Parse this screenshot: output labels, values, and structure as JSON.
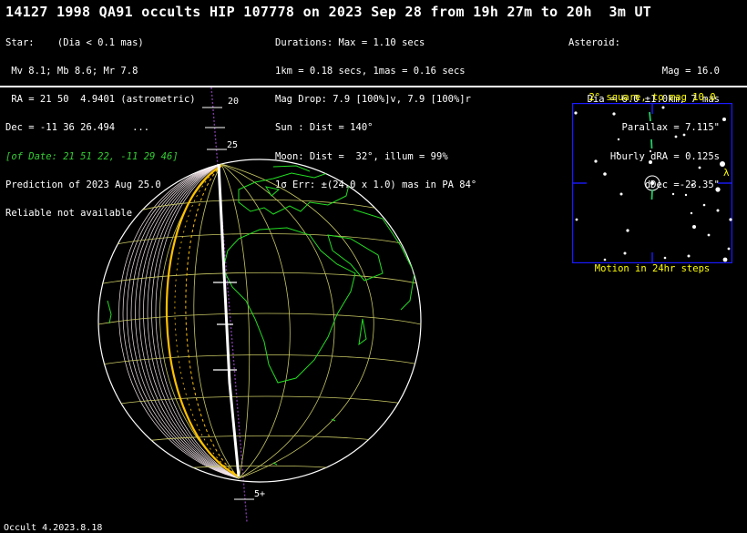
{
  "header": {
    "title": "14127 1998 QA91 occults HIP 107778 on 2023 Sep 28 from 19h 27m to 20h  3m UT"
  },
  "star": {
    "lines": [
      "Star:    (Dia < 0.1 mas)",
      " Mv 8.1; Mb 8.6; Mr 7.8",
      " RA = 21 50  4.9401 (astrometric)",
      "Dec = -11 36 26.494   ...",
      "[of Date: 21 51 22, -11 29 46]",
      "Prediction of 2023 Aug 25.0",
      "Reliable not available"
    ]
  },
  "event": {
    "lines": [
      "Durations: Max = 1.10 secs",
      "1km = 0.18 secs, 1mas = 0.16 secs",
      "Mag Drop: 7.9 [100%]v, 7.9 [100%]r",
      "Sun : Dist = 140°",
      "Moon: Dist =  32°, illum = 99%",
      "1σ Err: ±(24.0 x 1.0) mas in PA 84°"
    ]
  },
  "asteroid": {
    "heading": "Asteroid:",
    "lines": [
      "Mag = 16.0",
      "Dia = 6.0 ±1.0km, 7 mas",
      "Parallax = 7.115\"",
      "Hourly dRA = 0.125s",
      "dDec =-23.35\""
    ]
  },
  "track_labels": [
    "20",
    "25",
    "5+"
  ],
  "inset": {
    "title": "2° square, to mag 10.0",
    "caption": "Motion in 24hr steps",
    "lambda": "λ"
  },
  "footer": "Occult 4.2023.8.18",
  "colors": {
    "grid": "#c8c864",
    "coast": "#22dd22",
    "shadow_line": "#ffffff",
    "error_line": "#ffc000",
    "inset_box": "#1a1aff",
    "inset_text": "#ffff00",
    "track": "#8844aa"
  }
}
